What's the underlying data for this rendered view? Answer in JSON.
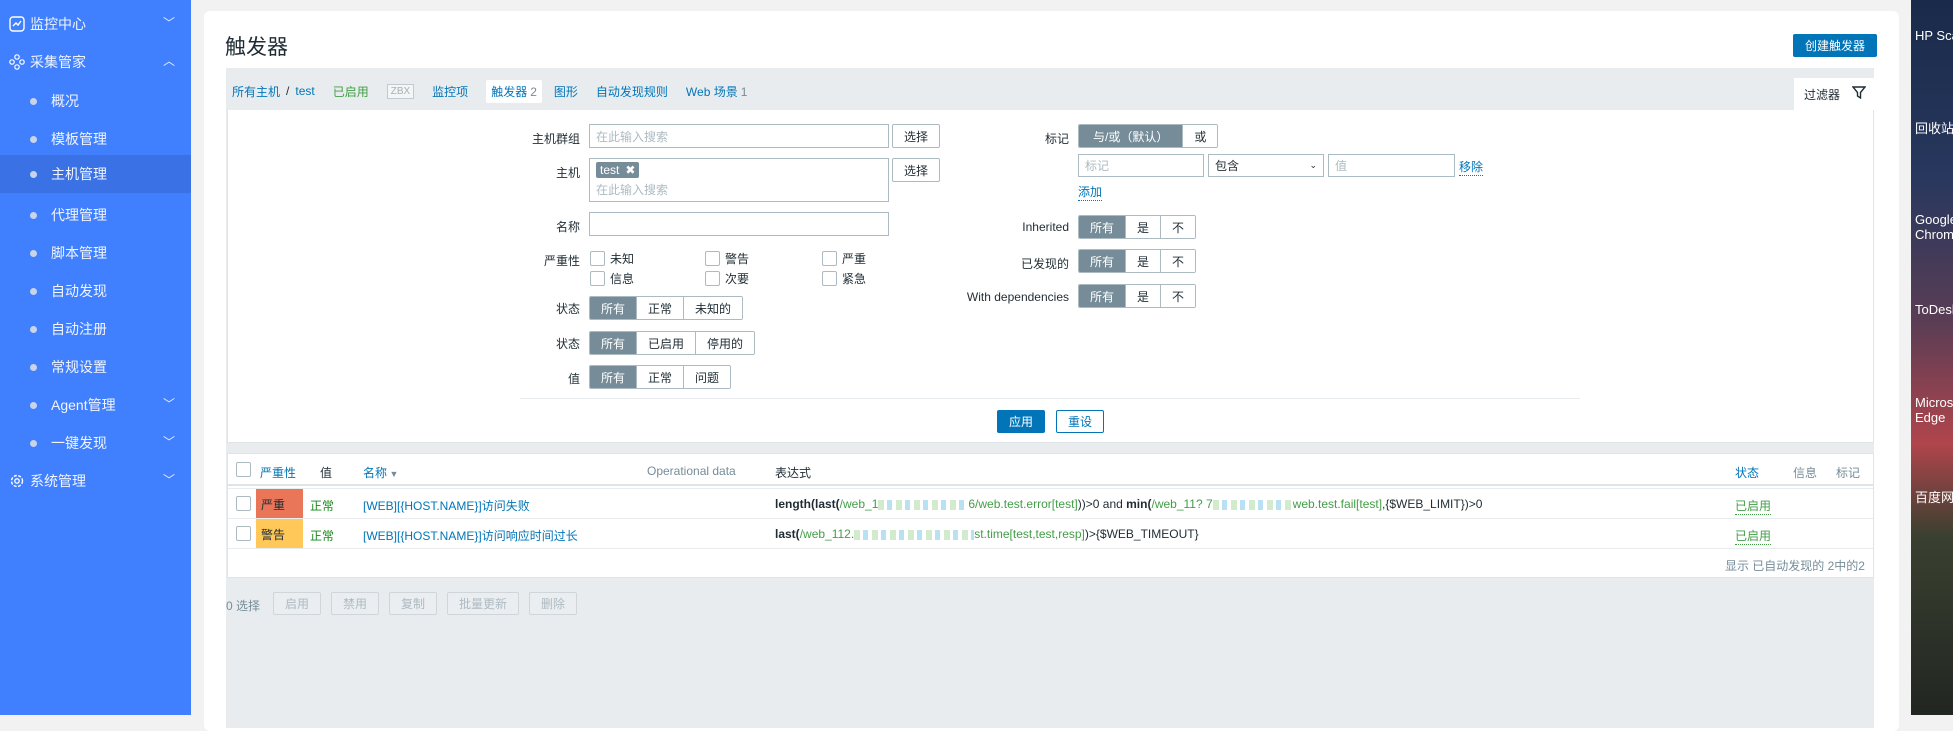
{
  "sidebar": {
    "items": [
      {
        "label": "监控中心",
        "icon": "chart-monitor-icon",
        "chevron": "down"
      },
      {
        "label": "采集管家",
        "icon": "nodes-icon",
        "chevron": "up"
      },
      {
        "label": "概况"
      },
      {
        "label": "模板管理"
      },
      {
        "label": "主机管理",
        "active": true
      },
      {
        "label": "代理管理"
      },
      {
        "label": "脚本管理"
      },
      {
        "label": "自动发现"
      },
      {
        "label": "自动注册"
      },
      {
        "label": "常规设置"
      },
      {
        "label": "Agent管理",
        "chevron": "down"
      },
      {
        "label": "一键发现",
        "chevron": "down"
      },
      {
        "label": "系统管理",
        "icon": "gear-icon",
        "chevron": "down"
      }
    ]
  },
  "header": {
    "title": "触发器",
    "create_button": "创建触发器"
  },
  "nav": {
    "all_hosts": "所有主机",
    "sep": "/",
    "host": "test",
    "status": "已启用",
    "zbx": "ZBX",
    "items": "监控项",
    "triggers": "触发器",
    "triggers_count": "2",
    "graphs": "图形",
    "discovery": "自动发现规则",
    "web": "Web 场景",
    "web_count": "1"
  },
  "filter": {
    "tab_label": "过滤器",
    "host_group_label": "主机群组",
    "placeholder": "在此输入搜索",
    "select": "选择",
    "host_label": "主机",
    "host_tag": "test",
    "name_label": "名称",
    "name_value": "",
    "severity_label": "严重性",
    "severities": [
      "未知",
      "警告",
      "严重",
      "信息",
      "次要",
      "紧急"
    ],
    "state_label": "状态",
    "state_options": [
      "所有",
      "正常",
      "未知的"
    ],
    "status_label": "状态",
    "status_options": [
      "所有",
      "已启用",
      "停用的"
    ],
    "value_label": "值",
    "value_options": [
      "所有",
      "正常",
      "问题"
    ],
    "tags_label": "标记",
    "tags_options": [
      "与/或（默认）",
      "或"
    ],
    "tag_placeholder": "标记",
    "tag_operator": "包含",
    "tag_value_placeholder": "值",
    "remove": "移除",
    "add": "添加",
    "inherited_label": "Inherited",
    "discovered_label": "已发现的",
    "deps_label": "With dependencies",
    "yn_options": [
      "所有",
      "是",
      "不"
    ],
    "apply": "应用",
    "reset": "重设"
  },
  "table": {
    "headers": {
      "severity": "严重性",
      "value": "值",
      "name": "名称",
      "opdata": "Operational data",
      "expression": "表达式",
      "status": "状态",
      "info": "信息",
      "tags": "标记"
    },
    "rows": [
      {
        "severity": "严重",
        "severity_color": "#e97659",
        "value": "正常",
        "name": "[WEB][{HOST.NAME}]访问失败",
        "expr": {
          "f1": "length(last(",
          "k1a": "/web_1",
          "k1b": "6/web.test.error[test]",
          "m1": "))>0 and ",
          "f2": "min(",
          "k2a": "/web_11? 7",
          "k2b": "web.test.fail[test]",
          "m2": ",{$WEB_LIMIT})>0"
        },
        "status": "已启用"
      },
      {
        "severity": "警告",
        "severity_color": "#ffc859",
        "value": "正常",
        "name": "[WEB][{HOST.NAME}]访问响应时间过长",
        "expr": {
          "f1": "last(",
          "k1a": "/web_112.",
          "k1b": "st.time[test,test,resp]",
          "m1": ")>{$WEB_TIMEOUT}"
        },
        "status": "已启用"
      }
    ],
    "footer": "显示 已自动发现的 2中的2"
  },
  "actions": {
    "selected": "0 选择",
    "buttons": [
      "启用",
      "禁用",
      "复制",
      "批量更新",
      "删除"
    ]
  },
  "desktop": {
    "icons": [
      "HP Scan",
      "回收站",
      "Google Chrome",
      "ToDesk",
      "Microsoft Edge",
      "百度网盘"
    ]
  },
  "colors": {
    "sidebar": "#4080ff",
    "primary": "#0275b8",
    "ok": "#429e47"
  }
}
